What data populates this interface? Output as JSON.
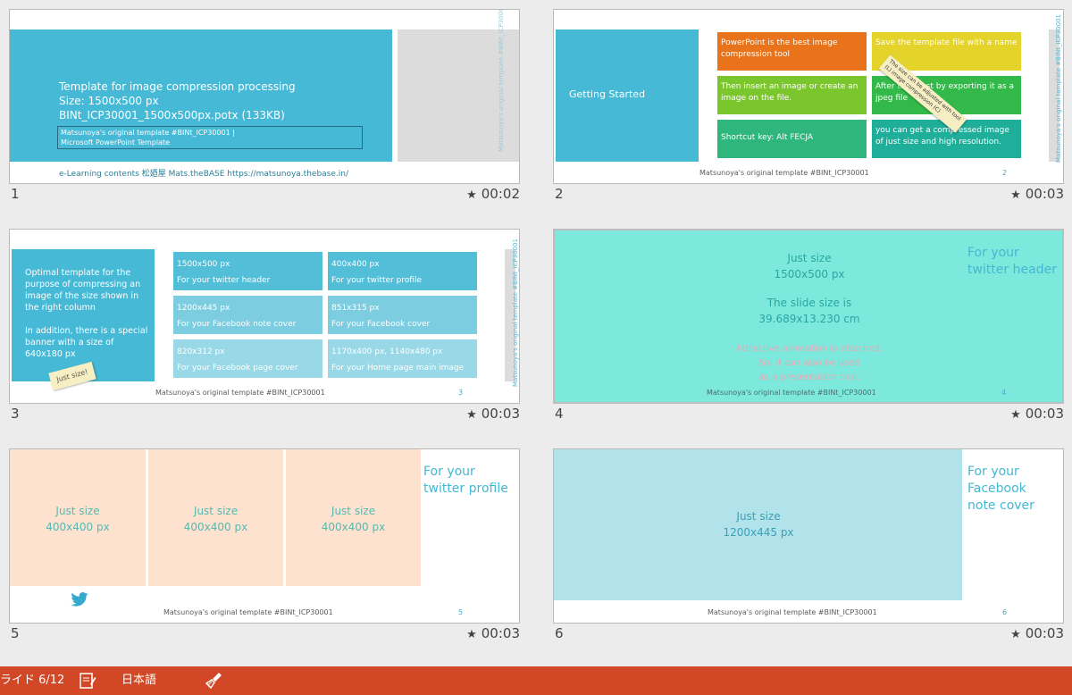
{
  "app": {
    "view": "slide-sorter"
  },
  "slides": [
    {
      "number": "1",
      "timing": "00:02",
      "title_lines": [
        "Template for image compression processing",
        "Size: 1500x500 px",
        "BINt_ICP30001_1500x500px.potx (133KB)"
      ],
      "box_lines": [
        "Matsunoya's original template #BINt_ICP30001 |",
        "Microsoft PowerPoint Template"
      ],
      "vertical": "Matsunoya's original template #BINt_ICP30001",
      "footer": "e-Learning contents     松廼屋 Mats.theBASE     https://matsunoya.thebase.in/"
    },
    {
      "number": "2",
      "timing": "00:03",
      "getting_started": "Getting Started",
      "tiles": [
        "PowerPoint is the best image compression tool",
        "Save the template file with a name",
        "Then insert an image or create an image on the file.",
        "After that, just by exporting it as a jpeg file",
        "Shortcut key: Alt FECJA",
        "you can get a compressed image of just size and high resolution."
      ],
      "sticker": "The size can be adjusted with tool (L) image compression (C)",
      "vertical": "Matsunoya's original template #BINt_ICP30001",
      "footer": "Matsunoya's original template #BINt_ICP30001",
      "page": "2"
    },
    {
      "number": "3",
      "timing": "00:03",
      "left_text": "Optimal template for the purpose of compressing an image of the size shown in the right column\n\nIn addition, there is a special banner with a size of 640x180 px",
      "sticker": "Just size!",
      "tiles": [
        {
          "size": "1500x500 px",
          "use": "For your twitter header"
        },
        {
          "size": "400x400 px",
          "use": "For your twitter profile"
        },
        {
          "size": "1200x445 px",
          "use": "For your Facebook note cover"
        },
        {
          "size": "851x315 px",
          "use": "For your Facebook cover"
        },
        {
          "size": "820x312 px",
          "use": "For your Facebook page cover"
        },
        {
          "size": "1170x400 px, 1140x480 px",
          "use": "For your Home page main image"
        }
      ],
      "vertical": "Matsunoya's original template #BINt_ICP30001",
      "footer": "Matsunoya's original template #BINt_ICP30001",
      "page": "3"
    },
    {
      "number": "4",
      "timing": "00:03",
      "just_size": "Just size",
      "dims": "1500x500 px",
      "slide_size_label": "The slide size is",
      "slide_size": "39.689x13.230 cm",
      "animation_lines": [
        "Attractive animation is attached.",
        "So, it can also be used",
        "as a presentation tool."
      ],
      "side_lines": [
        "For your",
        "twitter header"
      ],
      "footer": "Matsunoya's original template #BINt_ICP30001",
      "page": "4"
    },
    {
      "number": "5",
      "timing": "00:03",
      "panel_title": "Just size",
      "panel_dims": "400x400 px",
      "side_lines": [
        "For your",
        "twitter profile"
      ],
      "footer": "Matsunoya's original template #BINt_ICP30001",
      "page": "5"
    },
    {
      "number": "6",
      "timing": "00:03",
      "just_size": "Just size",
      "dims": "1200x445 px",
      "side_lines": [
        "For your",
        "Facebook",
        "note cover"
      ],
      "footer": "Matsunoya's original template #BINt_ICP30001",
      "page": "6"
    }
  ],
  "statusbar": {
    "slide_indicator": "ライド 6/12",
    "language": "日本語",
    "notes_icon": "notes-icon",
    "accessibility_icon": "broom-icon"
  },
  "colors": {
    "statusbar": "#d24726",
    "accent_blue": "#45b9d6",
    "mint": "#7de8dc",
    "peach": "#fde2cf",
    "light_blue": "#b2e3ea"
  }
}
